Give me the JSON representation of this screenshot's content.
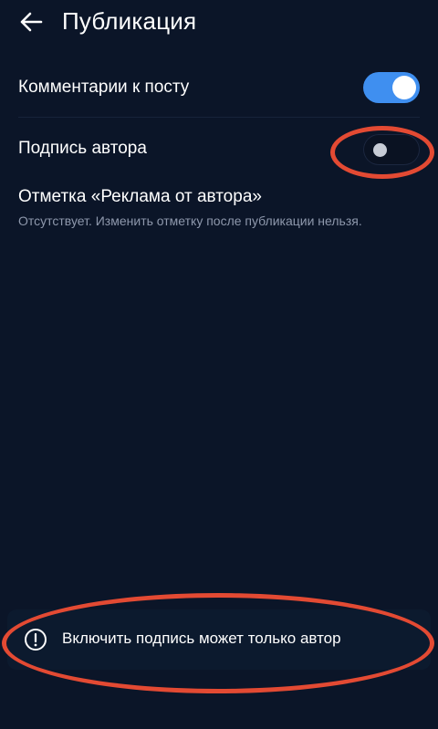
{
  "header": {
    "title": "Публикация",
    "back_icon": "arrow-left-icon"
  },
  "settings": {
    "comments": {
      "label": "Комментарии к посту",
      "enabled": true
    },
    "author_signature": {
      "label": "Подпись автора",
      "enabled": false
    },
    "ad_mark": {
      "title": "Отметка «Реклама от автора»",
      "subtitle": "Отсутствует. Изменить отметку после публикации нельзя."
    }
  },
  "notice": {
    "icon": "exclamation-circle-icon",
    "text": "Включить подпись может только автор"
  },
  "colors": {
    "background": "#0b1528",
    "accent": "#3f8ff0",
    "annotation": "#e34a33",
    "secondary_text": "#8e98ac"
  }
}
